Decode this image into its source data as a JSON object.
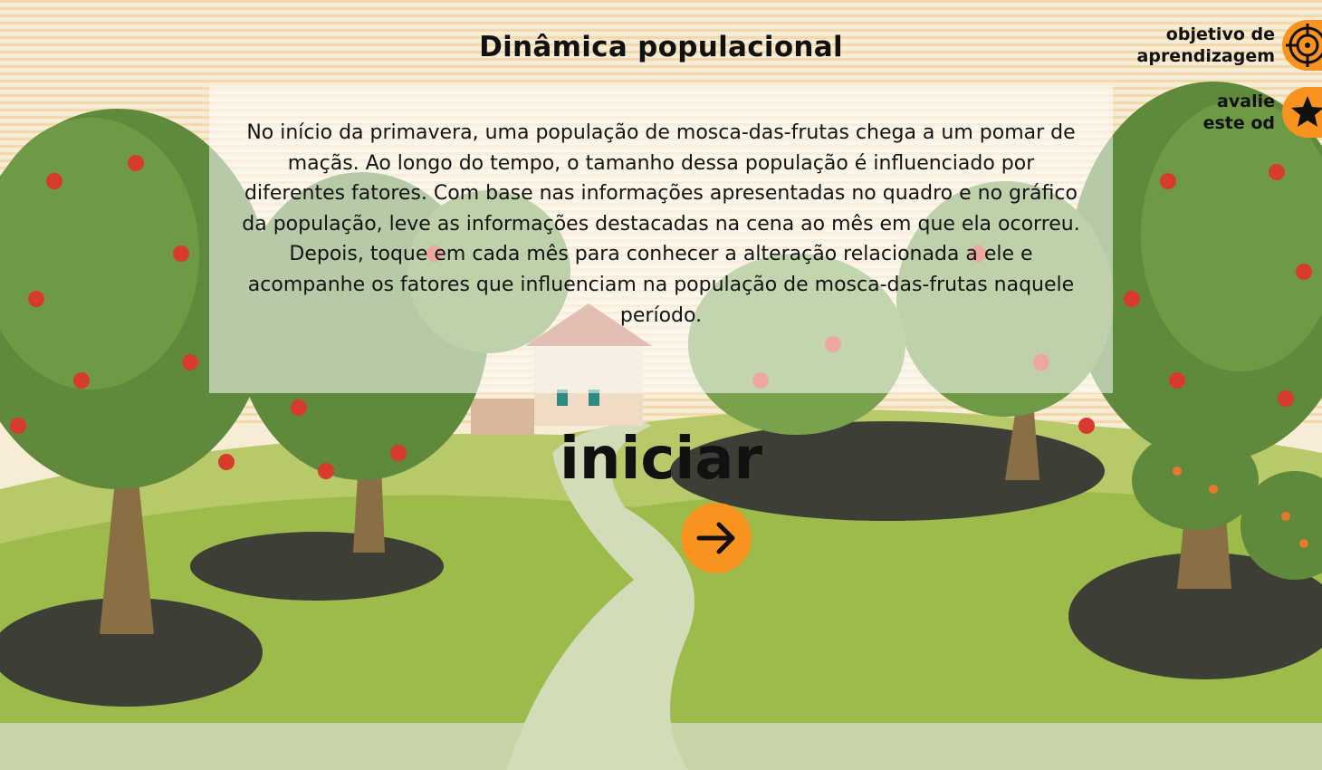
{
  "title": "Dinâmica populacional",
  "intro": "No início da primavera, uma população de mosca-das-frutas chega a um pomar de maçãs. Ao longo do tempo, o tamanho dessa população é influenciado por diferentes fatores. Com base nas informações apresentadas no quadro e no gráfico da população, leve as informações destacadas na cena ao mês em que ela ocorreu. Depois, toque em cada mês para conhecer a alteração relacionada a ele e acompanhe os fatores que influenciam na população de mosca-das-frutas naquele período.",
  "start": {
    "label": "iniciar",
    "icon": "arrow-right-icon"
  },
  "corner": {
    "objective": {
      "line1": "objetivo de",
      "line2": "aprendizagem",
      "icon": "target-icon"
    },
    "rate": {
      "line1": "avalie",
      "line2": "este od",
      "icon": "star-icon"
    }
  },
  "colors": {
    "accent": "#f7931e",
    "grass": "#9cbb4a",
    "path": "#d3dcb8",
    "sky": "#f6ead2"
  }
}
